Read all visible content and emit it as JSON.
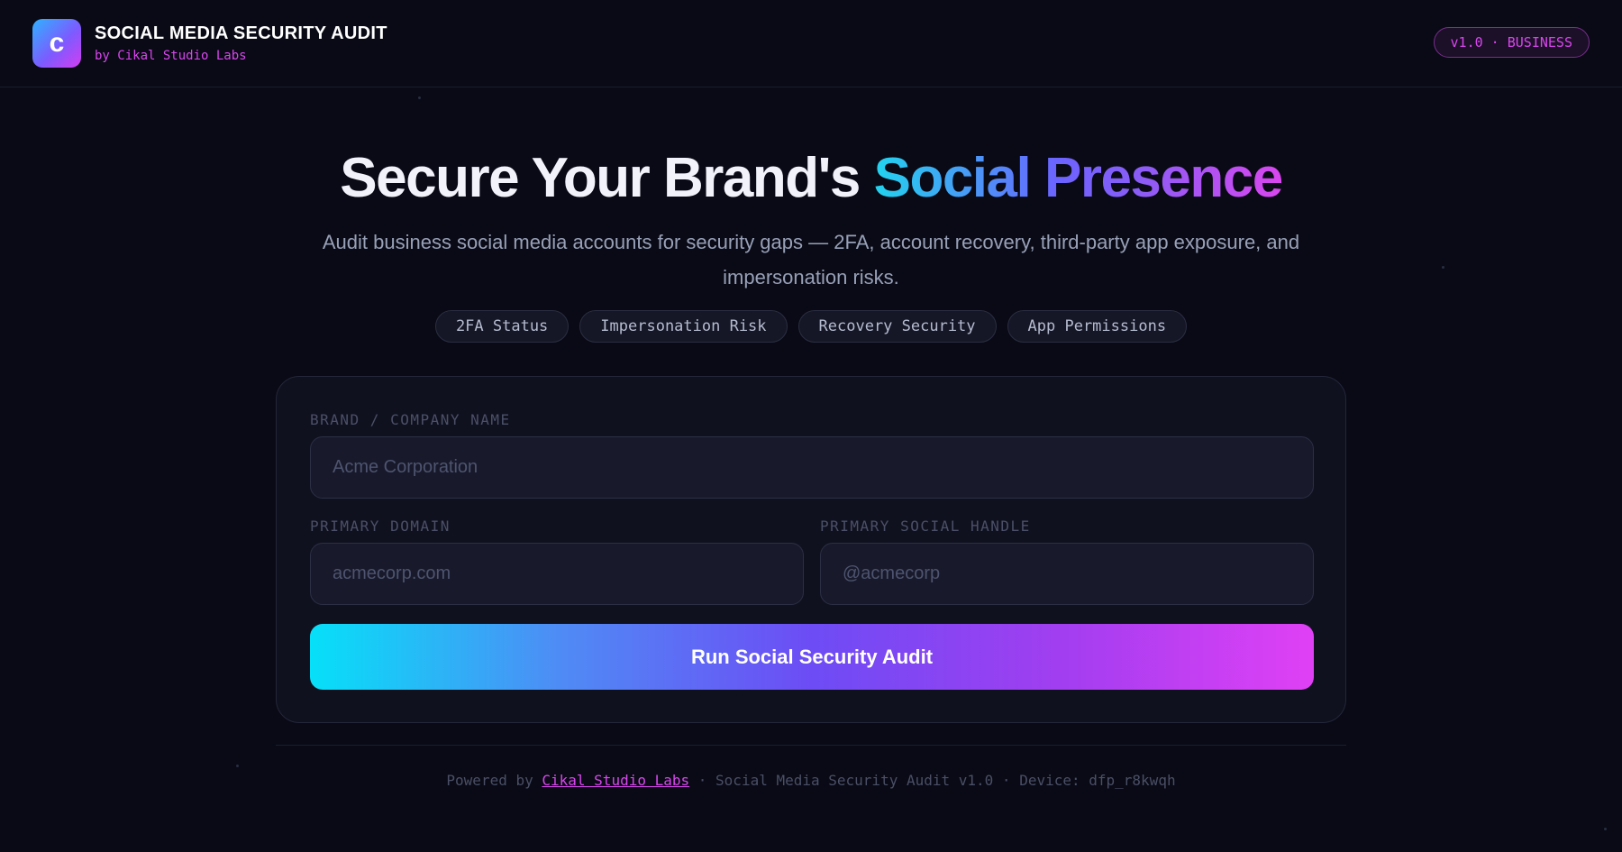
{
  "header": {
    "logo_letter": "c",
    "title": "SOCIAL MEDIA SECURITY AUDIT",
    "subtitle": "by Cikal Studio Labs",
    "version_badge": "v1.0 · BUSINESS"
  },
  "hero": {
    "title_plain": "Secure Your Brand's ",
    "title_highlight": "Social Presence",
    "description": "Audit business social media accounts for security gaps — 2FA, account recovery, third-party app exposure, and impersonation risks.",
    "chips": [
      "2FA Status",
      "Impersonation Risk",
      "Recovery Security",
      "App Permissions"
    ]
  },
  "form": {
    "brand_label": "BRAND / COMPANY NAME",
    "brand_placeholder": "Acme Corporation",
    "brand_value": "",
    "domain_label": "PRIMARY DOMAIN",
    "domain_placeholder": "acmecorp.com",
    "domain_value": "",
    "handle_label": "PRIMARY SOCIAL HANDLE",
    "handle_placeholder": "@acmecorp",
    "handle_value": "",
    "submit_label": "Run Social Security Audit"
  },
  "footer": {
    "prefix": "Powered by ",
    "link_text": "Cikal Studio Labs",
    "suffix": " · Social Media Security Audit v1.0 · Device: dfp_r8kwqh"
  },
  "colors": {
    "background": "#090a15",
    "accent_magenta": "#d946ef",
    "accent_cyan": "#06e0f8",
    "accent_violet": "#6d4cf5"
  },
  "icons": {
    "logo": "letter-c-logo-icon"
  }
}
